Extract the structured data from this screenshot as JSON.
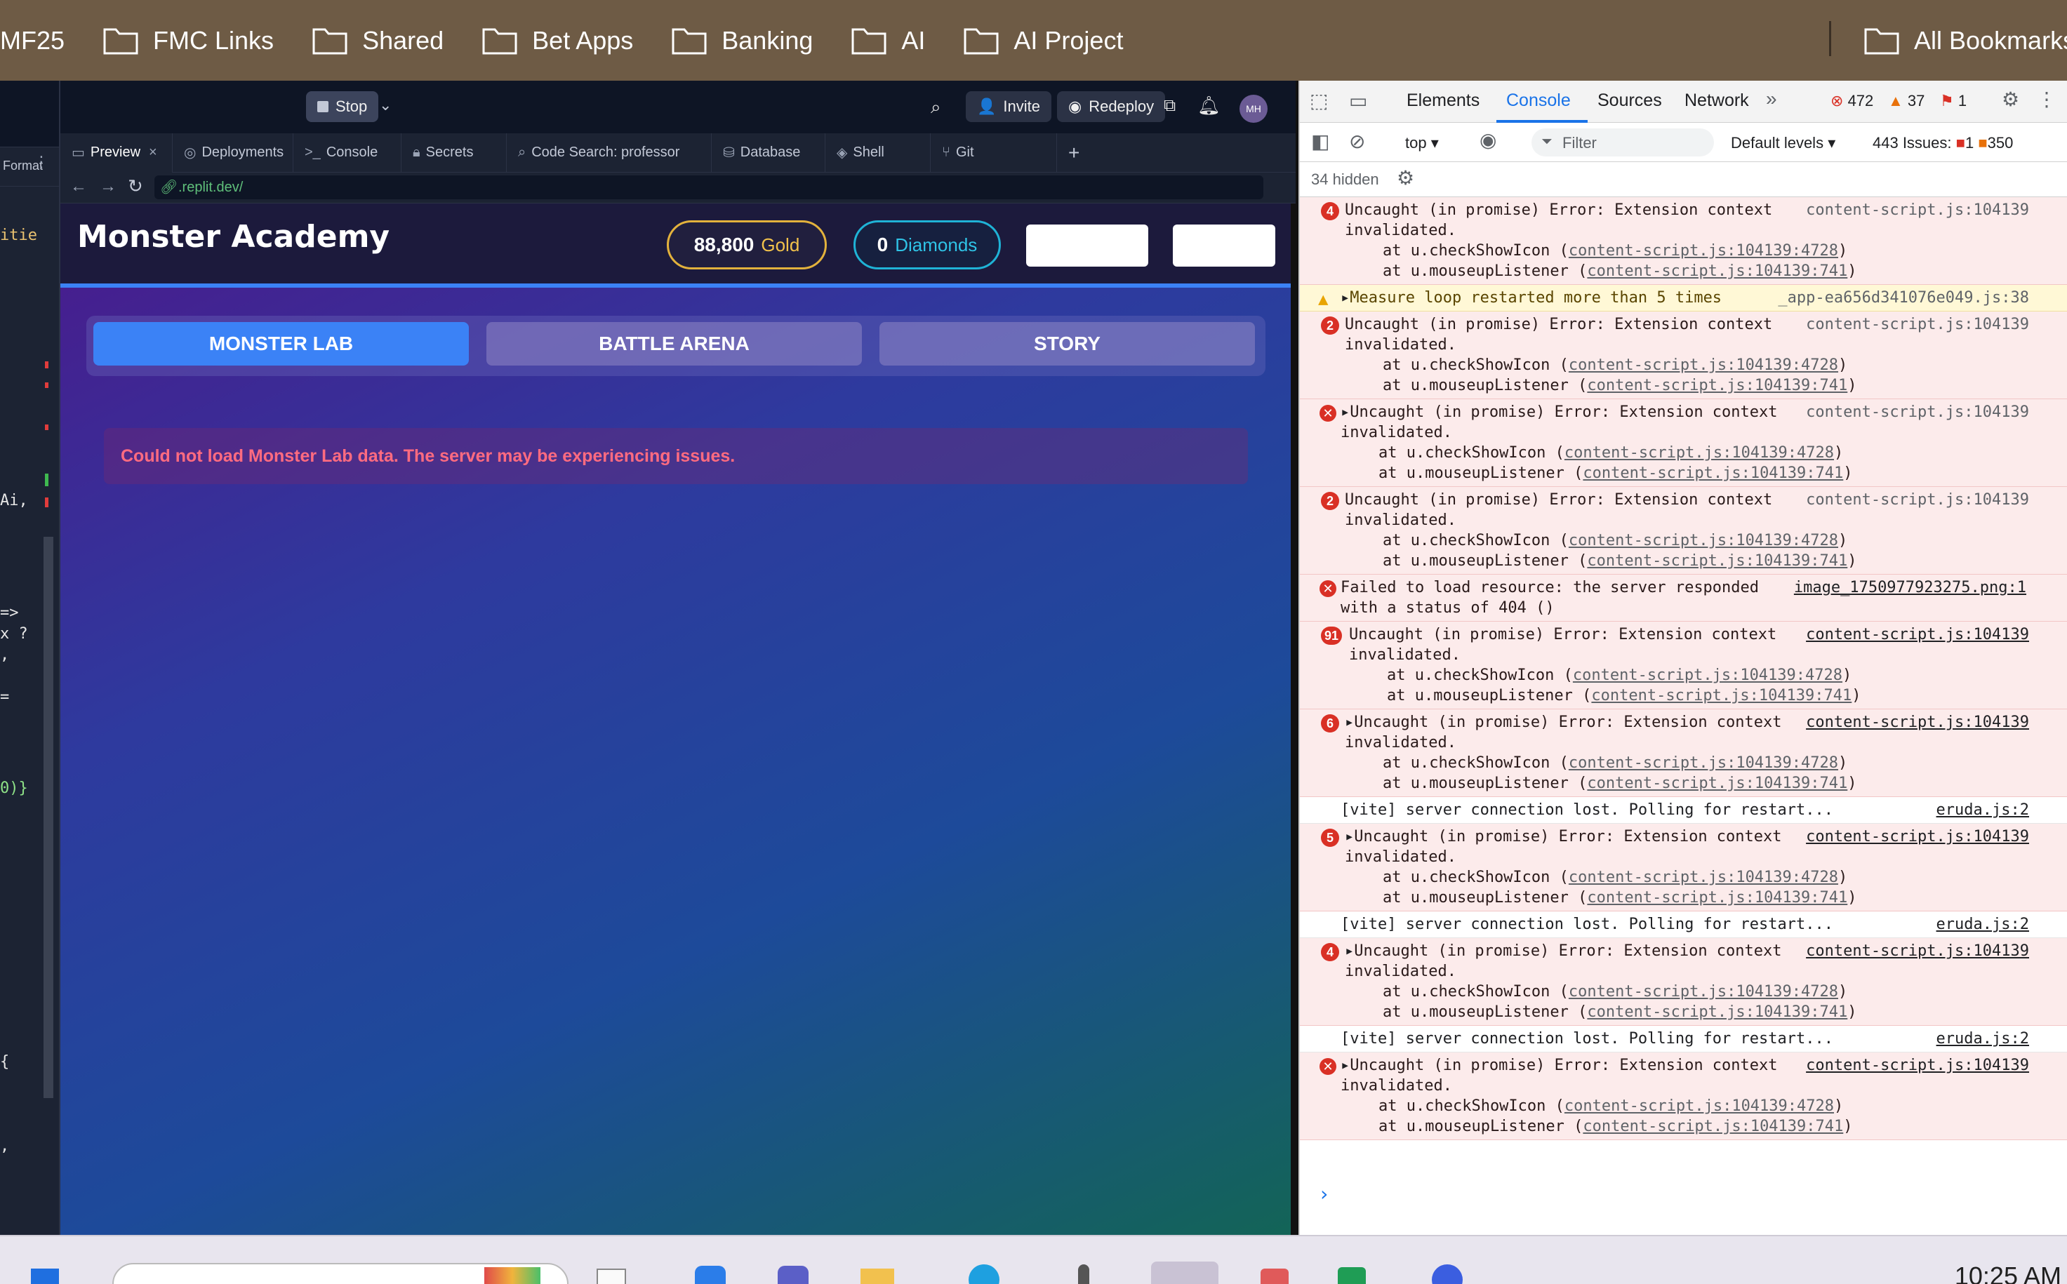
{
  "bookmarks": {
    "partial_first": "MF25",
    "items": [
      {
        "label": "FMC Links",
        "icon": "folder-icon"
      },
      {
        "label": "Shared",
        "icon": "folder-icon"
      },
      {
        "label": "Bet Apps",
        "icon": "folder-icon"
      },
      {
        "label": "Banking",
        "icon": "folder-icon"
      },
      {
        "label": "AI",
        "icon": "folder-icon"
      },
      {
        "label": "AI Project",
        "icon": "folder-icon"
      }
    ],
    "all_bookmarks": "All Bookmarks"
  },
  "editor": {
    "format_label": "Format",
    "lines": [
      "itie",
      "Ai,",
      "=>",
      "x ?",
      ",",
      "=",
      "0)}",
      "{",
      ","
    ]
  },
  "replit": {
    "stop_label": "Stop",
    "invite_label": "Invite",
    "redeploy_label": "Redeploy",
    "avatar_initials": "MH",
    "tabs": [
      {
        "label": "Preview",
        "icon": "preview-icon"
      },
      {
        "label": "Deployments",
        "icon": "deploy-icon"
      },
      {
        "label": "Console",
        "icon": "terminal-icon"
      },
      {
        "label": "Secrets",
        "icon": "lock-icon"
      },
      {
        "label": "Code Search: professor",
        "icon": "search-icon"
      },
      {
        "label": "Database",
        "icon": "database-icon"
      },
      {
        "label": "Shell",
        "icon": "shell-icon"
      },
      {
        "label": "Git",
        "icon": "git-icon"
      }
    ],
    "url": ".replit.dev/"
  },
  "app": {
    "title": "Monster Academy",
    "gold_value": "88,800",
    "gold_label": "Gold",
    "diamonds_value": "0",
    "diamonds_label": "Diamonds",
    "nav": [
      "MONSTER LAB",
      "BATTLE ARENA",
      "STORY"
    ],
    "error": "Could not load Monster Lab data. The server may be experiencing issues."
  },
  "devtools": {
    "tabs": [
      "Elements",
      "Console",
      "Sources",
      "Network"
    ],
    "error_count": "472",
    "warning_count": "37",
    "issue_flag_count": "1",
    "context": "top",
    "filter_placeholder": "Filter",
    "levels": "Default levels",
    "issues_label": "443 Issues:",
    "issues_err": "1",
    "issues_warn": "350",
    "hidden_label": "34 hidden",
    "messages": [
      {
        "kind": "err",
        "badge": "4",
        "expand": false,
        "l1": "Uncaught (in promise) Error: Extension context",
        "l2": "invalidated.",
        "s1": "at u.checkShowIcon (",
        "s1l": "content-script.js:104139:4728",
        "s2": "at u.mouseupListener (",
        "s2l": "content-script.js:104139:741",
        "src": "content-script.js:104139",
        "src_link": false
      },
      {
        "kind": "warn",
        "badge": "",
        "expand": true,
        "l1": "Measure loop restarted more than 5 times",
        "src": "_app-ea656d341076e049.js:38",
        "src_link": false
      },
      {
        "kind": "err",
        "badge": "2",
        "expand": false,
        "l1": "Uncaught (in promise) Error: Extension context",
        "l2": "invalidated.",
        "s1": "at u.checkShowIcon (",
        "s1l": "content-script.js:104139:4728",
        "s2": "at u.mouseupListener (",
        "s2l": "content-script.js:104139:741",
        "src": "content-script.js:104139",
        "src_link": false
      },
      {
        "kind": "err",
        "badge": "x",
        "expand": true,
        "l1": "Uncaught (in promise) Error: Extension context",
        "l2": "invalidated.",
        "s1": "at u.checkShowIcon (",
        "s1l": "content-script.js:104139:4728",
        "s2": "at u.mouseupListener (",
        "s2l": "content-script.js:104139:741",
        "src": "content-script.js:104139",
        "src_link": false
      },
      {
        "kind": "err",
        "badge": "2",
        "expand": false,
        "l1": "Uncaught (in promise) Error: Extension context",
        "l2": "invalidated.",
        "s1": "at u.checkShowIcon (",
        "s1l": "content-script.js:104139:4728",
        "s2": "at u.mouseupListener (",
        "s2l": "content-script.js:104139:741",
        "src": "content-script.js:104139",
        "src_link": false
      },
      {
        "kind": "res",
        "badge": "x",
        "l1": "Failed to load resource: the server responded",
        "l2": "with a status of 404 ()",
        "src": "image_1750977923275.png:1"
      },
      {
        "kind": "err",
        "badge": "91",
        "expand": false,
        "l1": "Uncaught (in promise) Error: Extension context",
        "l2": "invalidated.",
        "s1": "at u.checkShowIcon (",
        "s1l": "content-script.js:104139:4728",
        "s2": "at u.mouseupListener (",
        "s2l": "content-script.js:104139:741",
        "src": "content-script.js:104139",
        "src_link": true
      },
      {
        "kind": "err",
        "badge": "6",
        "expand": true,
        "l1": "Uncaught (in promise) Error: Extension context",
        "l2": "invalidated.",
        "s1": "at u.checkShowIcon (",
        "s1l": "content-script.js:104139:4728",
        "s2": "at u.mouseupListener (",
        "s2l": "content-script.js:104139:741",
        "src": "content-script.js:104139",
        "src_link": true
      },
      {
        "kind": "info",
        "l1": "[vite] server connection lost. Polling for restart...",
        "src": "eruda.js:2"
      },
      {
        "kind": "err",
        "badge": "5",
        "expand": true,
        "l1": "Uncaught (in promise) Error: Extension context",
        "l2": "invalidated.",
        "s1": "at u.checkShowIcon (",
        "s1l": "content-script.js:104139:4728",
        "s2": "at u.mouseupListener (",
        "s2l": "content-script.js:104139:741",
        "src": "content-script.js:104139",
        "src_link": true
      },
      {
        "kind": "info",
        "l1": "[vite] server connection lost. Polling for restart...",
        "src": "eruda.js:2"
      },
      {
        "kind": "err",
        "badge": "4",
        "expand": true,
        "l1": "Uncaught (in promise) Error: Extension context",
        "l2": "invalidated.",
        "s1": "at u.checkShowIcon (",
        "s1l": "content-script.js:104139:4728",
        "s2": "at u.mouseupListener (",
        "s2l": "content-script.js:104139:741",
        "src": "content-script.js:104139",
        "src_link": true
      },
      {
        "kind": "info",
        "l1": "[vite] server connection lost. Polling for restart...",
        "src": "eruda.js:2"
      },
      {
        "kind": "err",
        "badge": "x",
        "expand": true,
        "l1": "Uncaught (in promise) Error: Extension context",
        "l2": "invalidated.",
        "s1": "at u.checkShowIcon (",
        "s1l": "content-script.js:104139:4728",
        "s2": "at u.mouseupListener (",
        "s2l": "content-script.js:104139:741",
        "src": "content-script.js:104139",
        "src_link": true
      }
    ]
  },
  "taskbar": {
    "time": "10:25 AM"
  }
}
